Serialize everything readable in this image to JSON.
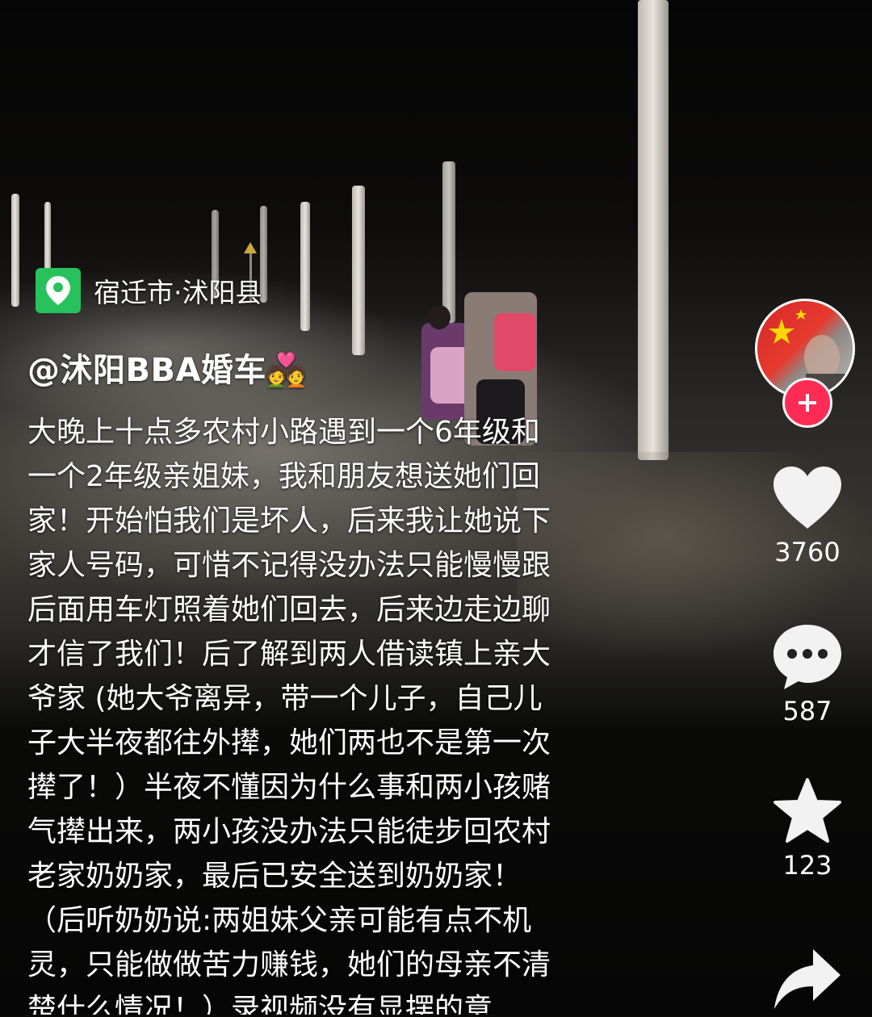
{
  "location": {
    "icon": "location-pin-icon",
    "text": "宿迁市·沭阳县"
  },
  "author": {
    "handle": "@沭阳BBA婚车💑"
  },
  "caption": "大晚上十点多农村小路遇到一个6年级和\n一个2年级亲姐妹，我和朋友想送她们回\n家！开始怕我们是坏人，后来我让她说下\n家人号码，可惜不记得没办法只能慢慢跟\n后面用车灯照着她们回去，后来边走边聊\n才信了我们！后了解到两人借读镇上亲大\n爷家 (她大爷离异，带一个儿子，自己儿\n子大半夜都往外撵，她们两也不是第一次\n撵了！）半夜不懂因为什么事和两小孩赌\n气撵出来，两小孩没办法只能徒步回农村\n老家奶奶家，最后已安全送到奶奶家！\n（后听奶奶说:两姐妹父亲可能有点不机\n灵，只能做做苦力赚钱，她们的母亲不清\n楚什么情况！）录视频没有显摆的意",
  "actions": {
    "like_count": "3760",
    "comment_count": "587",
    "favorite_count": "123"
  },
  "colors": {
    "location_badge": "#27c25b",
    "follow_button": "#fe2c55"
  }
}
